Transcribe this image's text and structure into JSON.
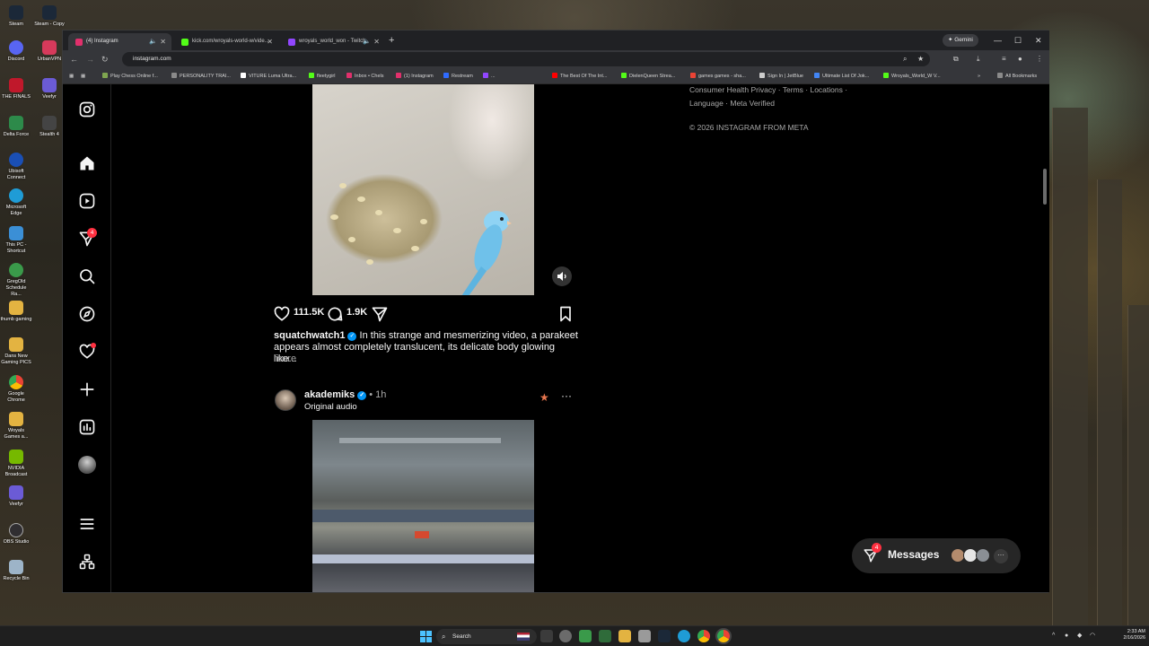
{
  "desktop": {
    "icons": [
      "Steam",
      "Steam - Copy",
      "Discord",
      "UrbanVPN",
      "THE FINALS",
      "Veefyr",
      "Delta Force",
      "Stealth 4",
      "Ubisoft Connect",
      "Microsoft Edge",
      "This PC - Shortcut",
      "GregOld Schedule Ra...",
      "thumb gaming",
      "Dans New Gaming PICS",
      "Google Chrome",
      "Woyals Games a...",
      "NVIDIA Broadcast",
      "Veefyr",
      "OBS Studio",
      "Recycle Bin"
    ]
  },
  "browser": {
    "tabs": [
      {
        "label": "(4) Instagram",
        "active": true,
        "color": "#e1306c"
      },
      {
        "label": "kick.com/wroyals-world-w/vide...",
        "active": false,
        "color": "#53fc18"
      },
      {
        "label": "wroyals_world_won - Twitch",
        "active": false,
        "color": "#9146ff"
      }
    ],
    "new_tab_glyph": "+",
    "gemini_label": "✦ Gemini",
    "window_controls": {
      "minimize": "—",
      "maximize": "☐",
      "close": "✕"
    },
    "url": "instagram.com",
    "bookmarks": [
      {
        "label": "Play Chess Online f...",
        "color": "#7fa650"
      },
      {
        "label": "PERSONALITY TRAI...",
        "color": "#8a8a8a"
      },
      {
        "label": "VITURE Luma Ultra...",
        "color": "#ffffff"
      },
      {
        "label": "fleetygirl",
        "color": "#53fc18"
      },
      {
        "label": "Inbox • Chels",
        "color": "#e1306c"
      },
      {
        "label": "(1) Instagram",
        "color": "#e1306c"
      },
      {
        "label": "Restream",
        "color": "#2f6bff"
      },
      {
        "label": "...",
        "color": "#9146ff"
      },
      {
        "label": "The Best Of The Int...",
        "color": "#ff0000"
      },
      {
        "label": "DielenQueen Strea...",
        "color": "#53fc18"
      },
      {
        "label": "games games - sha...",
        "color": "#ea4335"
      },
      {
        "label": "Sign In | JetBlue",
        "color": "#cccccc"
      },
      {
        "label": "Ultimate List Of Jok...",
        "color": "#4285f4"
      },
      {
        "label": "Wroyals_World_W V...",
        "color": "#53fc18"
      }
    ],
    "all_bookmarks_label": "All Bookmarks"
  },
  "instagram": {
    "sidebar": {
      "notifications_badge": "4"
    },
    "post1": {
      "likes": "111.5K",
      "comments": "1.9K",
      "username": "squatchwatch1",
      "caption": "In this strange and mesmerizing video, a parakeet appears almost completely translucent, its delicate body glowing like...",
      "more_label": "more"
    },
    "post2": {
      "username": "akademiks",
      "time": "1h",
      "audio": "Original audio",
      "separator": "•"
    },
    "footer": {
      "line1": "Consumer Health Privacy · Terms · Locations ·",
      "line2": "Language · Meta Verified",
      "copyright": "© 2026 INSTAGRAM FROM META"
    },
    "messages": {
      "label": "Messages",
      "badge": "4",
      "more": "···"
    }
  },
  "taskbar": {
    "search_placeholder": "Search",
    "time": "2:33 AM",
    "date": "2/16/2026"
  },
  "colors": {
    "accent_red": "#ff3040",
    "verified_blue": "#0095f6",
    "page_bg": "#000000",
    "chrome_toolbar": "#35363a"
  }
}
